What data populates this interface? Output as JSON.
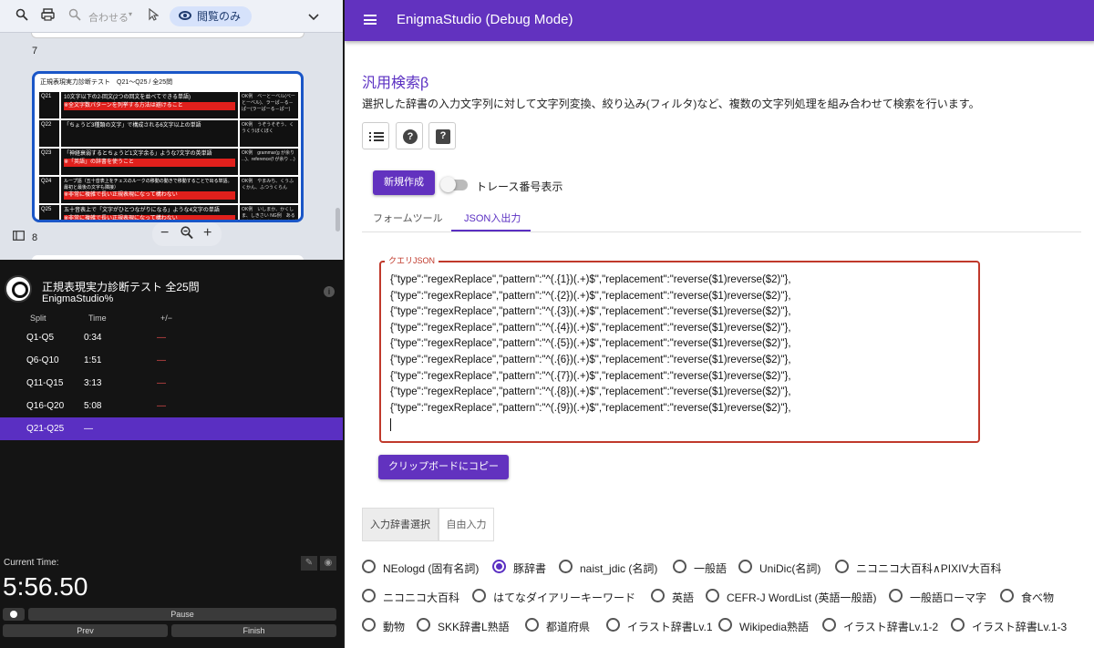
{
  "pdf_viewer": {
    "zoom_select": "合わせる",
    "view_mode": "閲覧のみ",
    "page_num_7": "7",
    "page_num_8": "8",
    "page_header": "正規表現実力診断テスト　Q21〜Q25 / 全25問",
    "questions": [
      {
        "num": "Q21",
        "text": "10文字以下の2-回文(2つの回文を並べてできる単語)",
        "red": "※全文字数パターンを列挙する方法は避けること",
        "answer": "OK例　ベーとーベル(ベーとーベル)、ラーぱ－る－ぱー(ラーぱーる－ぱー)"
      },
      {
        "num": "Q22",
        "text": "「ちょうど3種類の文字」で構成される6文字以上の単語",
        "red": "",
        "answer": "OK例　うぞうそぞう、くうくうぼくぼく"
      },
      {
        "num": "Q23",
        "text": "「神経衰弱するとちょうど1文字余る」ような7文字の英単語",
        "red": "※「英語」の辞書を使うこと",
        "answer": "OK例　grammar(g が余り ...)、reference(f が余り ...)"
      },
      {
        "num": "Q24",
        "text": "ループ語（五十音表上をチェスのルークの移動の動きで移動することで出る単語。最初と最後の文字も隣接）",
        "red": "※非常に複雑で長い正規表現になって構わない",
        "answer": "OK例　やまみち、くうふくかん、ふつうくらん"
      },
      {
        "num": "Q25",
        "text": "五十音表上で「文字がひとつながりになる」ような4文字の単語",
        "red": "※非常に複雑で長い正規表現になって構わない",
        "answer": "OK例　いしまか、かくしま、しきさい NG例　あるかり(あ-か、り-るはつながっているが、全体で見るとつながっていない)"
      }
    ]
  },
  "timer": {
    "title": "正規表現実力診断テスト 全25問",
    "subtitle": "EnigmaStudio%",
    "col_split": "Split",
    "col_time": "Time",
    "col_delta": "+/−",
    "rows": [
      {
        "split": "Q1-Q5",
        "time": "0:34",
        "delta": "—"
      },
      {
        "split": "Q6-Q10",
        "time": "1:51",
        "delta": "—"
      },
      {
        "split": "Q11-Q15",
        "time": "3:13",
        "delta": "—"
      },
      {
        "split": "Q16-Q20",
        "time": "5:08",
        "delta": "—"
      },
      {
        "split": "Q21-Q25",
        "time": "—",
        "delta": ""
      }
    ],
    "current_time_label": "Current Time:",
    "current_time": "5:56.50",
    "pause_label": "Pause",
    "prev_label": "Prev",
    "finish_label": "Finish"
  },
  "app": {
    "title": "EnigmaStudio (Debug Mode)",
    "heading": "汎用検索β",
    "description": "選択した辞書の入力文字列に対して文字列変換、絞り込み(フィルタ)など、複数の文字列処理を組み合わせて検索を行います。",
    "new_button": "新規作成",
    "trace_toggle_label": "トレース番号表示",
    "tabs": [
      "フォームツール",
      "JSON入出力"
    ],
    "json_legend": "クエリJSON",
    "json_lines": [
      "{\"type\":\"regexReplace\",\"pattern\":\"^(.{1})(.+)$\",\"replacement\":\"reverse($1)reverse($2)\"},",
      "{\"type\":\"regexReplace\",\"pattern\":\"^(.{2})(.+)$\",\"replacement\":\"reverse($1)reverse($2)\"},",
      "{\"type\":\"regexReplace\",\"pattern\":\"^(.{3})(.+)$\",\"replacement\":\"reverse($1)reverse($2)\"},",
      "{\"type\":\"regexReplace\",\"pattern\":\"^(.{4})(.+)$\",\"replacement\":\"reverse($1)reverse($2)\"},",
      "{\"type\":\"regexReplace\",\"pattern\":\"^(.{5})(.+)$\",\"replacement\":\"reverse($1)reverse($2)\"},",
      "{\"type\":\"regexReplace\",\"pattern\":\"^(.{6})(.+)$\",\"replacement\":\"reverse($1)reverse($2)\"},",
      "{\"type\":\"regexReplace\",\"pattern\":\"^(.{7})(.+)$\",\"replacement\":\"reverse($1)reverse($2)\"},",
      "{\"type\":\"regexReplace\",\"pattern\":\"^(.{8})(.+)$\",\"replacement\":\"reverse($1)reverse($2)\"},",
      "{\"type\":\"regexReplace\",\"pattern\":\"^(.{9})(.+)$\",\"replacement\":\"reverse($1)reverse($2)\"},"
    ],
    "copy_button": "クリップボードにコピー",
    "input_tabs": [
      "入力辞書選択",
      "自由入力"
    ],
    "dictionaries": [
      {
        "label": "NEologd (固有名詞)",
        "selected": false
      },
      {
        "label": "豚辞書",
        "selected": true
      },
      {
        "label": "naist_jdic (名詞)",
        "selected": false
      },
      {
        "label": "一般語",
        "selected": false
      },
      {
        "label": "UniDic(名詞)",
        "selected": false
      },
      {
        "label": "ニコニコ大百科∧PIXIV大百科",
        "selected": false
      },
      {
        "label": "ニコニコ大百科",
        "selected": false
      },
      {
        "label": "はてなダイアリーキーワード",
        "selected": false
      },
      {
        "label": "英語",
        "selected": false
      },
      {
        "label": "CEFR-J WordList (英語一般語)",
        "selected": false
      },
      {
        "label": "一般語ローマ字",
        "selected": false
      },
      {
        "label": "食べ物",
        "selected": false
      },
      {
        "label": "動物",
        "selected": false
      },
      {
        "label": "SKK辞書L熟語",
        "selected": false
      },
      {
        "label": "都道府県",
        "selected": false
      },
      {
        "label": "イラスト辞書Lv.1",
        "selected": false
      },
      {
        "label": "Wikipedia熟語",
        "selected": false
      },
      {
        "label": "イラスト辞書Lv.1-2",
        "selected": false
      },
      {
        "label": "イラスト辞書Lv.1-3",
        "selected": false
      }
    ],
    "colors": {
      "primary": "#6232bf",
      "error": "#c0392b"
    }
  }
}
